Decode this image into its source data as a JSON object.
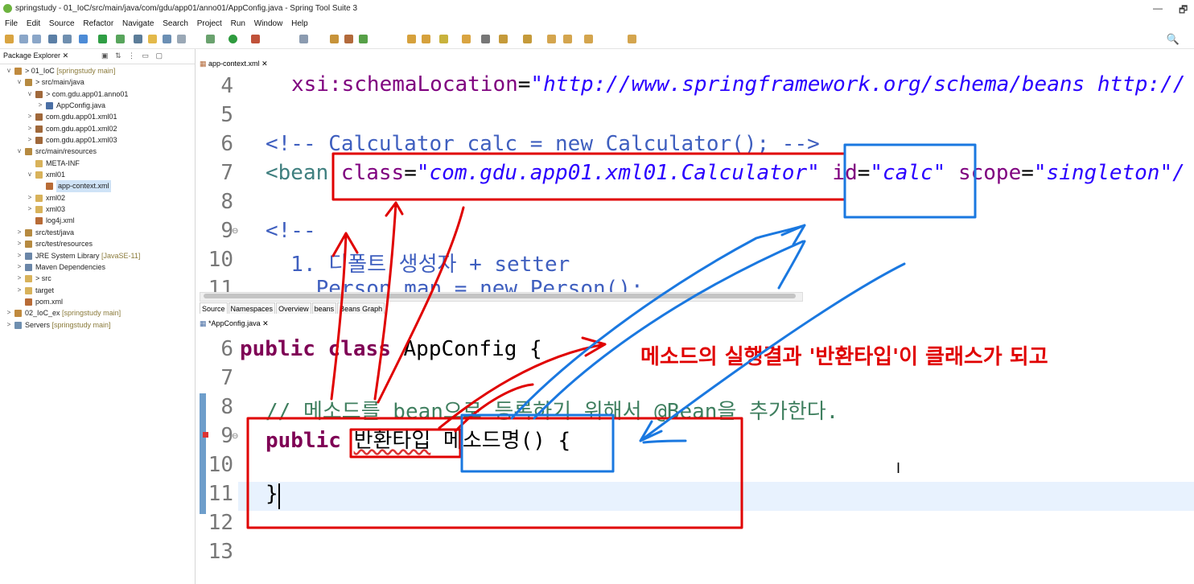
{
  "window": {
    "title": "springstudy - 01_IoC/src/main/java/com/gdu/app01/anno01/AppConfig.java - Spring Tool Suite 3",
    "minimize": "—",
    "restore": "🗗"
  },
  "menu": [
    "File",
    "Edit",
    "Source",
    "Refactor",
    "Navigate",
    "Search",
    "Project",
    "Run",
    "Window",
    "Help"
  ],
  "colors": {
    "annotation_red": "#e00000",
    "annotation_blue": "#1a78e0",
    "selection": "#cfe3f7"
  },
  "package_explorer": {
    "tab_label": "Package Explorer",
    "close": "✕",
    "tree": [
      {
        "arrow": "v",
        "icon": "project-icon",
        "label": "> 01_IoC",
        "dec": " [springstudy main]",
        "indent": 0
      },
      {
        "arrow": "v",
        "icon": "source-folder-icon",
        "label": "> src/main/java",
        "dec": "",
        "indent": 1
      },
      {
        "arrow": "v",
        "icon": "package-icon",
        "label": "> com.gdu.app01.anno01",
        "dec": "",
        "indent": 2
      },
      {
        "arrow": ">",
        "icon": "java-file-icon",
        "label": "AppConfig.java",
        "dec": "",
        "indent": 3
      },
      {
        "arrow": ">",
        "icon": "package-icon",
        "label": "com.gdu.app01.xml01",
        "dec": "",
        "indent": 2
      },
      {
        "arrow": ">",
        "icon": "package-icon",
        "label": "com.gdu.app01.xml02",
        "dec": "",
        "indent": 2
      },
      {
        "arrow": ">",
        "icon": "package-icon",
        "label": "com.gdu.app01.xml03",
        "dec": "",
        "indent": 2
      },
      {
        "arrow": "v",
        "icon": "source-folder-icon",
        "label": "src/main/resources",
        "dec": "",
        "indent": 1
      },
      {
        "arrow": "",
        "icon": "folder-icon",
        "label": "META-INF",
        "dec": "",
        "indent": 2
      },
      {
        "arrow": "v",
        "icon": "folder-icon",
        "label": "xml01",
        "dec": "",
        "indent": 2
      },
      {
        "arrow": "",
        "icon": "xml-file-icon",
        "label": "app-context.xml",
        "dec": "",
        "indent": 3,
        "selected": true
      },
      {
        "arrow": ">",
        "icon": "folder-icon",
        "label": "xml02",
        "dec": "",
        "indent": 2
      },
      {
        "arrow": ">",
        "icon": "folder-icon",
        "label": "xml03",
        "dec": "",
        "indent": 2
      },
      {
        "arrow": "",
        "icon": "xml-file-icon",
        "label": "log4j.xml",
        "dec": "",
        "indent": 2
      },
      {
        "arrow": ">",
        "icon": "source-folder-icon",
        "label": "src/test/java",
        "dec": "",
        "indent": 1
      },
      {
        "arrow": ">",
        "icon": "source-folder-icon",
        "label": "src/test/resources",
        "dec": "",
        "indent": 1
      },
      {
        "arrow": ">",
        "icon": "library-icon",
        "label": "JRE System Library",
        "dec": " [JavaSE-11]",
        "indent": 1
      },
      {
        "arrow": ">",
        "icon": "library-icon",
        "label": "Maven Dependencies",
        "dec": "",
        "indent": 1
      },
      {
        "arrow": ">",
        "icon": "folder-icon",
        "label": "> src",
        "dec": "",
        "indent": 1
      },
      {
        "arrow": ">",
        "icon": "folder-icon",
        "label": "target",
        "dec": "",
        "indent": 1
      },
      {
        "arrow": "",
        "icon": "xml-file-icon",
        "label": "pom.xml",
        "dec": "",
        "indent": 1
      },
      {
        "arrow": ">",
        "icon": "project-icon",
        "label": "02_IoC_ex",
        "dec": " [springstudy main]",
        "indent": 0
      },
      {
        "arrow": ">",
        "icon": "servers-icon",
        "label": "Servers",
        "dec": " [springstudy main]",
        "indent": 0
      }
    ]
  },
  "xml_editor": {
    "tab_label": "app-context.xml",
    "close": "✕",
    "bottom_tabs": [
      "Source",
      "Namespaces",
      "Overview",
      "beans",
      "Beans Graph"
    ],
    "lines": {
      "l4": {
        "num": "4",
        "attr": "xsi:schemaLocation",
        "eq": "=",
        "val": "\"http://www.springframework.org/schema/beans http://"
      },
      "l5": {
        "num": "5"
      },
      "l6": {
        "num": "6",
        "comment": "<!-- Calculator calc = new Calculator(); -->"
      },
      "l7": {
        "num": "7",
        "open": "<bean ",
        "a1": "class",
        "v1": "\"com.gdu.app01.xml01.Calculator\"",
        "a2": "id",
        "v2": "\"calc\"",
        "a3": "scope",
        "v3": "\"singleton\"/"
      },
      "l8": {
        "num": "8"
      },
      "l9": {
        "num": "9",
        "fold": "⊖",
        "comment": "<!--"
      },
      "l10": {
        "num": "10",
        "comment": "  1. 디폴트 생성자 + setter"
      },
      "l11": {
        "num": "11",
        "comment": "    Person man = new Person();"
      }
    }
  },
  "java_editor": {
    "tab_label": "*AppConfig.java",
    "close": "✕",
    "lines": {
      "l6": {
        "num": "6",
        "kw1": "public",
        "kw2": "class",
        "rest": " AppConfig {"
      },
      "l7": {
        "num": "7"
      },
      "l8": {
        "num": "8",
        "comment": "// 메소드를 bean으로 등록하기 위해서 @Bean을 추가한다."
      },
      "l9": {
        "num": "9",
        "fold": "⊖",
        "kw": "public",
        "type": "반환타입",
        "rest": " 메소드명() {"
      },
      "l10": {
        "num": "10"
      },
      "l11": {
        "num": "11",
        "text": "}"
      },
      "l12": {
        "num": "12"
      },
      "l13": {
        "num": "13"
      }
    }
  },
  "annotation": {
    "text": "메소드의 실행결과 '반환타입'이 클래스가 되고"
  },
  "cursor": "I"
}
